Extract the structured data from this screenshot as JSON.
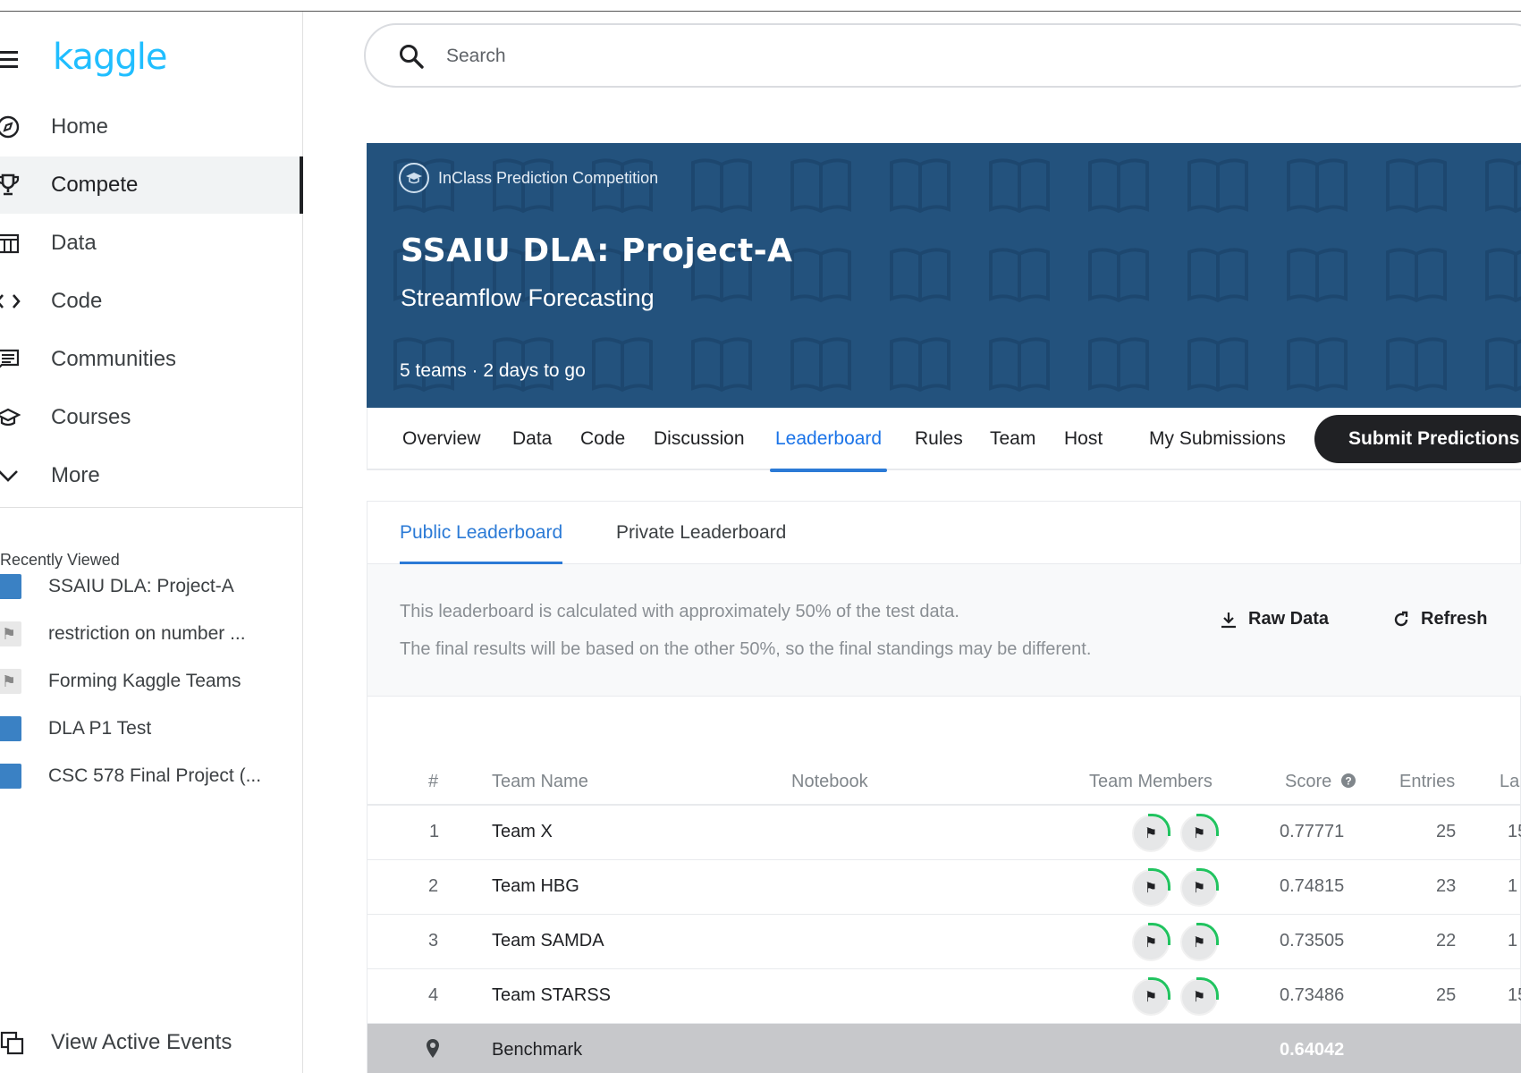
{
  "sidebar": {
    "logo": "kaggle",
    "nav": [
      {
        "label": "Home",
        "icon": "compass-icon"
      },
      {
        "label": "Compete",
        "icon": "trophy-icon",
        "active": true
      },
      {
        "label": "Data",
        "icon": "table-icon"
      },
      {
        "label": "Code",
        "icon": "code-icon"
      },
      {
        "label": "Communities",
        "icon": "comment-icon"
      },
      {
        "label": "Courses",
        "icon": "school-icon"
      },
      {
        "label": "More",
        "icon": "chevron-down-icon"
      }
    ],
    "recently_viewed_title": "Recently Viewed",
    "recently_viewed": [
      {
        "label": "SSAIU DLA: Project-A"
      },
      {
        "label": "restriction on number ..."
      },
      {
        "label": "Forming Kaggle Teams"
      },
      {
        "label": "DLA P1 Test"
      },
      {
        "label": "CSC 578 Final Project (..."
      }
    ],
    "view_events": "View Active Events"
  },
  "search": {
    "placeholder": "Search"
  },
  "banner": {
    "type_label": "InClass Prediction Competition",
    "title": "SSAIU DLA: Project-A",
    "subtitle": "Streamflow Forecasting",
    "meta": "5 teams · 2 days to go"
  },
  "tabs": [
    {
      "label": "Overview"
    },
    {
      "label": "Data"
    },
    {
      "label": "Code"
    },
    {
      "label": "Discussion"
    },
    {
      "label": "Leaderboard",
      "active": true
    },
    {
      "label": "Rules"
    },
    {
      "label": "Team"
    },
    {
      "label": "Host"
    },
    {
      "label": "My Submissions"
    }
  ],
  "submit_label": "Submit Predictions",
  "leaderboard": {
    "subtabs": [
      "Public Leaderboard",
      "Private Leaderboard"
    ],
    "notice_line1": "This leaderboard is calculated with approximately 50% of the test data.",
    "notice_line2": "The final results will be based on the other 50%, so the final standings may be different.",
    "raw_data_label": "Raw Data",
    "refresh_label": "Refresh",
    "columns": {
      "rank": "#",
      "team": "Team Name",
      "notebook": "Notebook",
      "members": "Team Members",
      "score": "Score",
      "entries": "Entries",
      "last": "La"
    },
    "rows": [
      {
        "rank": "1",
        "team": "Team X",
        "score": "0.77771",
        "entries": "25",
        "last": "15"
      },
      {
        "rank": "2",
        "team": "Team HBG",
        "score": "0.74815",
        "entries": "23",
        "last": "1"
      },
      {
        "rank": "3",
        "team": "Team SAMDA",
        "score": "0.73505",
        "entries": "22",
        "last": "1"
      },
      {
        "rank": "4",
        "team": "Team STARSS",
        "score": "0.73486",
        "entries": "25",
        "last": "15"
      }
    ],
    "benchmark": {
      "team": "Benchmark",
      "score": "0.64042"
    }
  },
  "colors": {
    "brand": "#20beff",
    "banner": "#23527d",
    "accent": "#2b7ad6",
    "progress_ring": "#20c35f"
  }
}
